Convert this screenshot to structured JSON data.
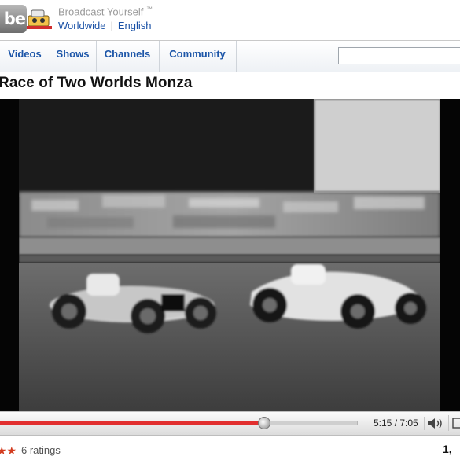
{
  "header": {
    "logo_text": "be",
    "tagline": "Broadcast Yourself",
    "tagline_mark": "™",
    "region": "Worldwide",
    "language": "English"
  },
  "nav": {
    "tabs": [
      {
        "label": "Videos"
      },
      {
        "label": "Shows"
      },
      {
        "label": "Channels"
      },
      {
        "label": "Community"
      }
    ],
    "search_value": ""
  },
  "video": {
    "title": "Race of Two Worlds Monza",
    "current_time": "5:15",
    "duration": "7:05",
    "time_display": "5:15 / 7:05",
    "progress": 0.7376
  },
  "meta": {
    "stars_visible": "★★",
    "ratings": "6 ratings",
    "views_partial": "1,"
  },
  "colors": {
    "link": "#1c55a8",
    "progress_red": "#e22f2f",
    "star": "#d23b1e"
  }
}
